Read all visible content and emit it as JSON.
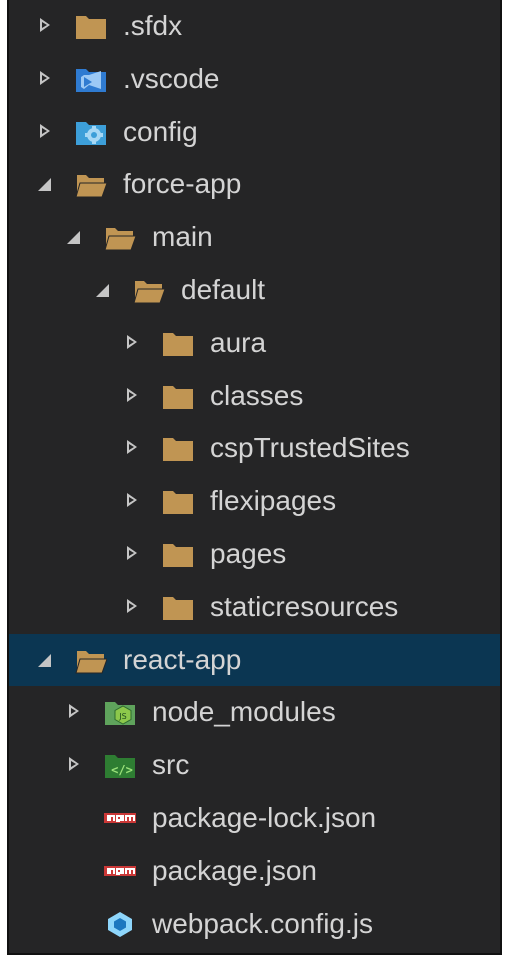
{
  "explorer": {
    "items": [
      {
        "label": ".sfdx",
        "depth": 0,
        "state": "collapsed",
        "icon": "folder-icon"
      },
      {
        "label": ".vscode",
        "depth": 0,
        "state": "collapsed",
        "icon": "vscode-folder-icon"
      },
      {
        "label": "config",
        "depth": 0,
        "state": "collapsed",
        "icon": "config-folder-icon"
      },
      {
        "label": "force-app",
        "depth": 0,
        "state": "expanded",
        "icon": "folder-open-icon"
      },
      {
        "label": "main",
        "depth": 1,
        "state": "expanded",
        "icon": "folder-open-icon"
      },
      {
        "label": "default",
        "depth": 2,
        "state": "expanded",
        "icon": "folder-open-icon"
      },
      {
        "label": "aura",
        "depth": 3,
        "state": "collapsed",
        "icon": "folder-icon"
      },
      {
        "label": "classes",
        "depth": 3,
        "state": "collapsed",
        "icon": "folder-icon"
      },
      {
        "label": "cspTrustedSites",
        "depth": 3,
        "state": "collapsed",
        "icon": "folder-icon"
      },
      {
        "label": "flexipages",
        "depth": 3,
        "state": "collapsed",
        "icon": "folder-icon"
      },
      {
        "label": "pages",
        "depth": 3,
        "state": "collapsed",
        "icon": "folder-icon"
      },
      {
        "label": "staticresources",
        "depth": 3,
        "state": "collapsed",
        "icon": "folder-icon"
      },
      {
        "label": "react-app",
        "depth": 0,
        "state": "expanded",
        "icon": "folder-open-icon",
        "selected": true
      },
      {
        "label": "node_modules",
        "depth": 1,
        "state": "collapsed",
        "icon": "node-folder-icon"
      },
      {
        "label": "src",
        "depth": 1,
        "state": "collapsed",
        "icon": "src-folder-icon"
      },
      {
        "label": "package-lock.json",
        "depth": 1,
        "state": "file",
        "icon": "npm-icon"
      },
      {
        "label": "package.json",
        "depth": 1,
        "state": "file",
        "icon": "npm-icon"
      },
      {
        "label": "webpack.config.js",
        "depth": 1,
        "state": "file",
        "icon": "webpack-icon"
      }
    ]
  },
  "colors": {
    "background": "#252526",
    "text": "#d4d4d4",
    "selected_row": "#0b3652",
    "folder": "#c09553",
    "vscode_blue": "#2f7bd1",
    "config_blue": "#3d9fd9",
    "node_green": "#5fa35c",
    "npm_red": "#cb3837",
    "webpack_blue": "#8ed6fb"
  }
}
